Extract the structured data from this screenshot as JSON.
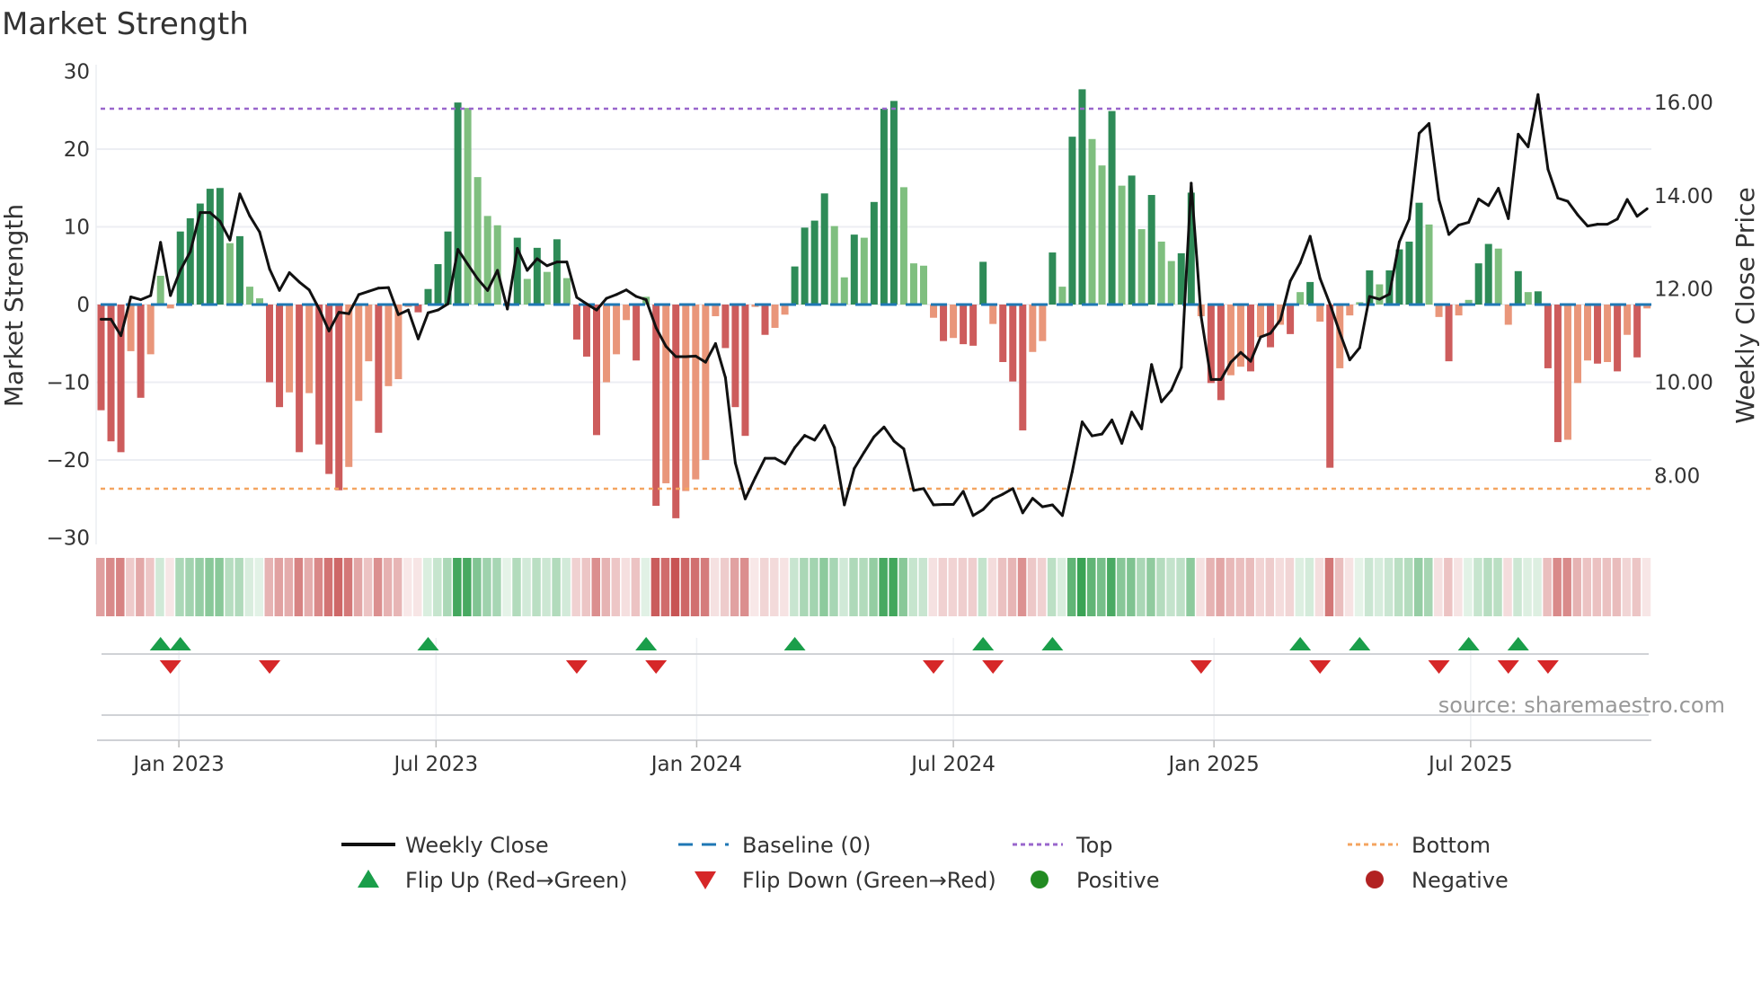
{
  "chart_data": {
    "type": "bar",
    "title": "Market Strength",
    "ylabel": "Market Strength",
    "y2label": "Weekly Close Price",
    "ylim": [
      -30,
      30
    ],
    "y2lim": [
      7.33,
      17.33
    ],
    "yticks": [
      "30",
      "20",
      "10",
      "0",
      "−10",
      "−20",
      "−30"
    ],
    "ytick_values": [
      30,
      20,
      10,
      0,
      -10,
      -20,
      -30
    ],
    "y2ticks": [
      "16.00",
      "14.00",
      "12.00",
      "10.00",
      "8.00"
    ],
    "y2tick_values": [
      16,
      14,
      12,
      10,
      8
    ],
    "xticks": [
      {
        "label": "Jan 2023",
        "week": 7.85
      },
      {
        "label": "Jul 2023",
        "week": 33.8
      },
      {
        "label": "Jan 2024",
        "week": 60.1
      },
      {
        "label": "Jul 2024",
        "week": 86.0
      },
      {
        "label": "Jan 2025",
        "week": 112.3
      },
      {
        "label": "Jul 2025",
        "week": 138.2
      }
    ],
    "top_level": 25.2,
    "bottom_level": -23.7,
    "baseline": 0,
    "strength": [
      -13.6,
      -17.6,
      -19,
      -6,
      -12,
      -6.4,
      3.7,
      -0.5,
      9.4,
      11.1,
      13,
      14.9,
      15,
      7.9,
      8.8,
      2.3,
      0.8,
      -10,
      -13.2,
      -11.3,
      -19,
      -11.4,
      -18,
      -21.8,
      -23.9,
      -20.9,
      -12.4,
      -7.3,
      -16.5,
      -10.5,
      -9.6,
      -0.3,
      -1,
      2,
      5.2,
      9.4,
      26,
      25.3,
      16.4,
      11.4,
      10.2,
      0.2,
      8.6,
      3.3,
      7.3,
      4.2,
      8.4,
      3.4,
      -4.5,
      -6.7,
      -16.8,
      -10,
      -6.4,
      -2,
      -7.2,
      1,
      -25.9,
      -23,
      -27.5,
      -24,
      -22.5,
      -20,
      -1.5,
      -5.6,
      -13.2,
      -16.9,
      -0.3,
      -3.9,
      -3,
      -1.3,
      4.9,
      9.9,
      10.8,
      14.3,
      10.1,
      3.5,
      9,
      8.6,
      13.2,
      25.2,
      26.2,
      15.1,
      5.3,
      5,
      -1.7,
      -4.7,
      -4.3,
      -5.1,
      -5.3,
      5.5,
      -2.5,
      -7.4,
      -9.9,
      -16.2,
      -6.1,
      -4.7,
      6.7,
      2.3,
      21.6,
      27.7,
      21.3,
      17.9,
      24.9,
      15.3,
      16.6,
      9.7,
      14.1,
      8.1,
      5.6,
      6.6,
      14.4,
      -1.5,
      -10.1,
      -12.3,
      -9.1,
      -8,
      -8.6,
      -4.2,
      -5.5,
      -2.6,
      -3.8,
      1.6,
      2.9,
      -2.2,
      -21,
      -8.2,
      -1.4,
      0.3,
      4.4,
      2.6,
      4.4,
      7.1,
      8.1,
      13.1,
      10.3,
      -1.6,
      -7.3,
      -1.4,
      0.6,
      5.3,
      7.8,
      7.2,
      -2.6,
      4.3,
      1.6,
      1.7,
      -8.2,
      -17.7,
      -17.4,
      -10.1,
      -7.2,
      -7.6,
      -7.4,
      -8.6,
      -3.9,
      -6.8,
      -0.5
    ],
    "weekly_close": [
      11.35,
      11.35,
      11.0,
      11.83,
      11.77,
      11.86,
      13.0,
      11.86,
      12.4,
      12.8,
      13.64,
      13.64,
      13.45,
      13.05,
      14.04,
      13.57,
      13.22,
      12.43,
      11.97,
      12.35,
      12.15,
      11.98,
      11.57,
      11.1,
      11.5,
      11.47,
      11.88,
      11.95,
      12.02,
      12.03,
      11.45,
      11.55,
      10.93,
      11.49,
      11.55,
      11.68,
      12.85,
      12.53,
      12.22,
      11.97,
      12.4,
      11.57,
      12.87,
      12.4,
      12.65,
      12.5,
      12.58,
      12.58,
      11.82,
      11.68,
      11.55,
      11.8,
      11.88,
      11.98,
      11.84,
      11.77,
      11.17,
      10.77,
      10.55,
      10.55,
      10.56,
      10.43,
      10.83,
      10.1,
      8.27,
      7.5,
      7.95,
      8.37,
      8.37,
      8.25,
      8.6,
      8.86,
      8.76,
      9.07,
      8.6,
      7.37,
      8.15,
      8.5,
      8.83,
      9.04,
      8.74,
      8.57,
      7.68,
      7.72,
      7.37,
      7.38,
      7.38,
      7.66,
      7.14,
      7.27,
      7.5,
      7.6,
      7.72,
      7.2,
      7.51,
      7.33,
      7.37,
      7.14,
      8.08,
      9.15,
      8.85,
      8.89,
      9.19,
      8.69,
      9.36,
      9.0,
      10.38,
      9.58,
      9.83,
      10.32,
      14.27,
      11.42,
      10.06,
      10.06,
      10.43,
      10.64,
      10.45,
      10.97,
      11.05,
      11.34,
      12.17,
      12.56,
      13.13,
      12.23,
      11.68,
      11.06,
      10.48,
      10.74,
      11.84,
      11.78,
      11.89,
      13.01,
      13.5,
      15.34,
      15.55,
      13.92,
      13.17,
      13.37,
      13.43,
      13.93,
      13.79,
      14.16,
      13.51,
      15.32,
      15.05,
      16.17,
      14.57,
      13.95,
      13.88,
      13.59,
      13.35,
      13.39,
      13.39,
      13.5,
      13.92,
      13.56,
      13.72
    ],
    "flip_up_weeks": [
      6,
      8,
      33,
      55,
      70,
      89,
      96,
      121,
      127,
      138,
      143
    ],
    "flip_down_weeks": [
      7,
      17,
      48,
      56,
      84,
      90,
      111,
      123,
      135,
      142,
      146
    ],
    "legend": {
      "placement": "bottom",
      "items": [
        {
          "label": "Weekly Close",
          "kind": "line"
        },
        {
          "label": "Baseline (0)",
          "kind": "dash"
        },
        {
          "label": "Top",
          "kind": "dot-top"
        },
        {
          "label": "Bottom",
          "kind": "dot-bottom"
        },
        {
          "label": "Flip Up (Red→Green)",
          "kind": "tri-up"
        },
        {
          "label": "Flip Down (Green→Red)",
          "kind": "tri-down"
        },
        {
          "label": "Positive",
          "kind": "circle-pos"
        },
        {
          "label": "Negative",
          "kind": "circle-neg"
        }
      ]
    },
    "source": "source: sharemaestro.com",
    "colors": {
      "pos_strong": "#2e8b57",
      "pos_weak": "#7fbf7f",
      "neg_strong": "#cd5c5c",
      "neg_weak": "#e9967a",
      "line": "#111111",
      "baseline": "#1f77b4",
      "top": "#9966cc",
      "bottom": "#f4a460",
      "flip_up": "#1a9e4a",
      "flip_down": "#d62728",
      "positive": "#228b22",
      "negative": "#b22222"
    }
  }
}
